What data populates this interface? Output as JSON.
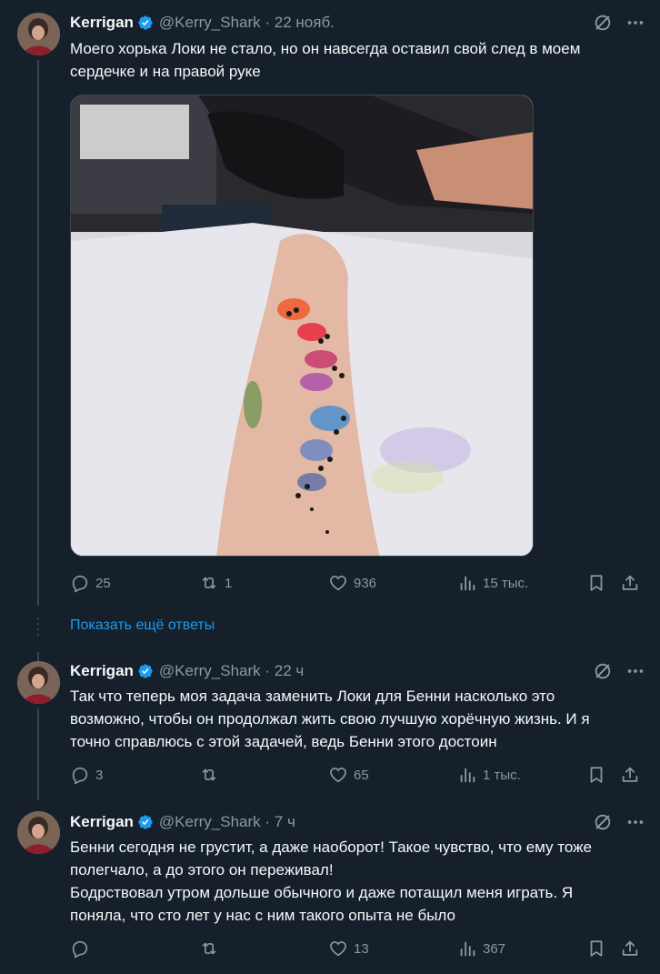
{
  "tweets": [
    {
      "name": "Kerrigan",
      "handle": "@Kerry_Shark · 22 нояб.",
      "text": "Моего хорька Локи не стало, но он навсегда оставил свой след в моем сердечке и на правой руке",
      "replies": "25",
      "retweets": "1",
      "likes": "936",
      "views": "15 тыс."
    },
    {
      "name": "Kerrigan",
      "handle": "@Kerry_Shark · 22 ч",
      "text": "Так что теперь моя задача заменить Локи для Бенни насколько это возможно, чтобы он продолжал жить свою лучшую хорёчную жизнь. И я точно справлюсь с этой задачей, ведь Бенни этого достоин",
      "replies": "3",
      "retweets": "",
      "likes": "65",
      "views": "1 тыс."
    },
    {
      "name": "Kerrigan",
      "handle": "@Kerry_Shark · 7 ч",
      "text": "Бенни сегодня не грустит, а даже наоборот! Такое чувство, что ему тоже полегчало, а до этого он переживал!\nБодрствовал утром дольше обычного и даже потащил меня играть. Я поняла, что сто лет у нас с ним такого опыта не было",
      "replies": "",
      "retweets": "",
      "likes": "13",
      "views": "367"
    }
  ],
  "show_more": "Показать ещё ответы",
  "icons": {
    "verified": "verified-badge-icon",
    "grok": "grok-icon",
    "more": "more-icon",
    "reply": "reply-icon",
    "retweet": "retweet-icon",
    "like": "like-icon",
    "views": "views-icon",
    "bookmark": "bookmark-icon",
    "share": "share-icon"
  },
  "colors": {
    "background": "#15202b",
    "accent": "#1d9bf0",
    "muted": "#8b98a5"
  }
}
